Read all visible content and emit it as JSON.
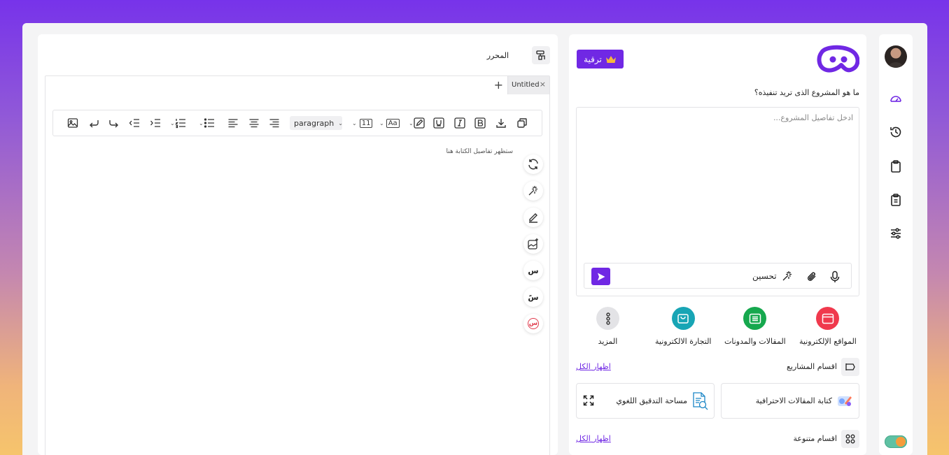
{
  "rail": {
    "items": [
      {
        "icon": "gauge-icon"
      },
      {
        "icon": "history-icon"
      },
      {
        "icon": "clipboard-icon"
      },
      {
        "icon": "clipboard-list-icon"
      },
      {
        "icon": "sliders-icon"
      }
    ]
  },
  "project": {
    "upgrade_label": "ترقية",
    "question": "ما هو المشروع الذى تريد تنفيذه؟",
    "input_placeholder": "ادخل تفاصيل المشروع...",
    "improve_label": "تحسين"
  },
  "categories": [
    {
      "label": "المواقع الإلكترونية",
      "color": "#f0394d"
    },
    {
      "label": "المقالات والمدونات",
      "color": "#16a84e"
    },
    {
      "label": "التجارة الالكترونية",
      "color": "#18a5b5"
    },
    {
      "label": "المزيد",
      "color": "#e3e3e6"
    }
  ],
  "sections": {
    "projects": {
      "title": "اقسام المشاريع",
      "show_all": "اظهار الكل"
    },
    "cards": [
      {
        "label": "كتابة المقالات الاحترافية"
      },
      {
        "label": "مساحة التدقيق اللغوي"
      }
    ],
    "misc": {
      "title": "اقسام متنوعة",
      "show_all": "اظهار الكل"
    }
  },
  "editor": {
    "title": "المحرر",
    "tab_label": "Untitled",
    "tab_close": "×",
    "add_tab": "+",
    "paragraph_select": "paragraph",
    "font_size": "11",
    "font_label": "Aa",
    "placeholder": "ستظهر تفاصيل الكتابة هنا",
    "glyphs": [
      "س",
      "سً",
      "س"
    ]
  },
  "colors": {
    "accent": "#7028e4"
  }
}
